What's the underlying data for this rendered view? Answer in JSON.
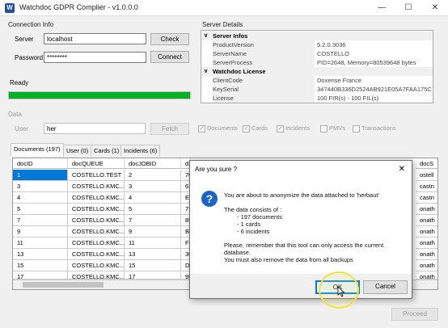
{
  "window": {
    "title": "Watchdoc GDPR Complier - v1.0.0.0",
    "icon": "W"
  },
  "connection": {
    "group_label": "Connection Info",
    "server_label": "Server",
    "server_value": "localhost",
    "password_label": "Password",
    "password_value": "********",
    "check_button": "Check",
    "connect_button": "Connect"
  },
  "status": {
    "text": "Ready",
    "progress": 1.0
  },
  "server_details": {
    "group_label": "Server Details",
    "sections": [
      {
        "title": "Server Infos",
        "rows": [
          {
            "key": "ProductVersion",
            "value": "5.2.0.3036"
          },
          {
            "key": "ServerName",
            "value": "COSTELLO"
          },
          {
            "key": "ServerProcess",
            "value": "PID=2648, Memory=80539648 bytes"
          }
        ]
      },
      {
        "title": "Watchdoc License",
        "rows": [
          {
            "key": "ClientCode",
            "value": "Doxense France"
          },
          {
            "key": "KeySerial",
            "value": "347440B336D2524AB921E05A7FAA175C"
          },
          {
            "key": "License",
            "value": "100 FIR(s) - 100 FIL(s)"
          }
        ]
      }
    ]
  },
  "data": {
    "group_label": "Data",
    "user_label": "User",
    "user_value": "her",
    "fetch_button": "Fetch",
    "checks": [
      {
        "label": "Documents",
        "checked": true
      },
      {
        "label": "Cards",
        "checked": true
      },
      {
        "label": "Incidents",
        "checked": true
      },
      {
        "label": "PMVs",
        "checked": false
      },
      {
        "label": "Transactions",
        "checked": false
      }
    ]
  },
  "tabs": [
    {
      "label": "Documents (197)",
      "active": true
    },
    {
      "label": "User (0)",
      "active": false
    },
    {
      "label": "Cards (1)",
      "active": false
    },
    {
      "label": "Incidents (6)",
      "active": false
    }
  ],
  "grid": {
    "columns": [
      "docID",
      "docQUEUE",
      "docJOBID",
      "d",
      "docS"
    ],
    "rows": [
      [
        "1",
        "COSTELLO.TEST",
        "2",
        "70",
        "ostell"
      ],
      [
        "3",
        "COSTELLO.KMC...",
        "3",
        "61",
        "castn"
      ],
      [
        "4",
        "COSTELLO.KMC...",
        "4",
        "El",
        "castn"
      ],
      [
        "5",
        "COSTELLO.KMC...",
        "5",
        "7!",
        "onath"
      ],
      [
        "7",
        "COSTELLO.KMC...",
        "7",
        "85",
        "onath"
      ],
      [
        "9",
        "COSTELLO.KMC...",
        "9",
        "Ba",
        "onath"
      ],
      [
        "11",
        "COSTELLO.KMC...",
        "11",
        "F0",
        "onath"
      ],
      [
        "13",
        "COSTELLO.KMC...",
        "13",
        "3t",
        "onath"
      ],
      [
        "15",
        "COSTELLO.KMC...",
        "15",
        "Dc",
        "onath"
      ],
      [
        "17",
        "COSTELLO.KMC...",
        "17",
        "9f",
        "onath"
      ]
    ]
  },
  "proceed_button": "Proceed",
  "dialog": {
    "title": "Are you sure ?",
    "close": "✕",
    "icon": "question-icon",
    "line1": "You are about to anonymize the data attached to 'herbaut'",
    "line2": "The data consists of :",
    "items": [
      "- 197 documents",
      "- 1 cards",
      "- 6 incidents"
    ],
    "line3": "Please, remember that this tool can only access the current",
    "line4": "database.",
    "line5": "You must also remove the data from all backups",
    "ok_button": "OK",
    "cancel_button": "Cancel"
  }
}
